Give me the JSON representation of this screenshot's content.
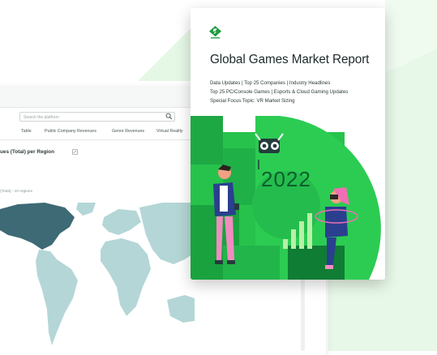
{
  "dashboard": {
    "search_placeholder": "Search the platform",
    "tabs": [
      "Table",
      "Public Company Revenues",
      "Genre Revenues",
      "Virtual Reality"
    ],
    "section_title": "ues (Total) per Region",
    "subcaption": "(Total) - 10 regions"
  },
  "report": {
    "title": "Global Games Market Report",
    "lines": [
      "Data Updates | Top 25 Companies | Industry Headlines",
      "Top 25 PC/Console Games | Esports & Cloud Gaming Updates",
      "Special Focus Topic: VR Market Sizing"
    ],
    "year": "2022"
  },
  "colors": {
    "brand_green": "#27c24c",
    "dark_green": "#0e6b34",
    "map_dark": "#3d6b75",
    "map_light": "#b7d8d8"
  }
}
